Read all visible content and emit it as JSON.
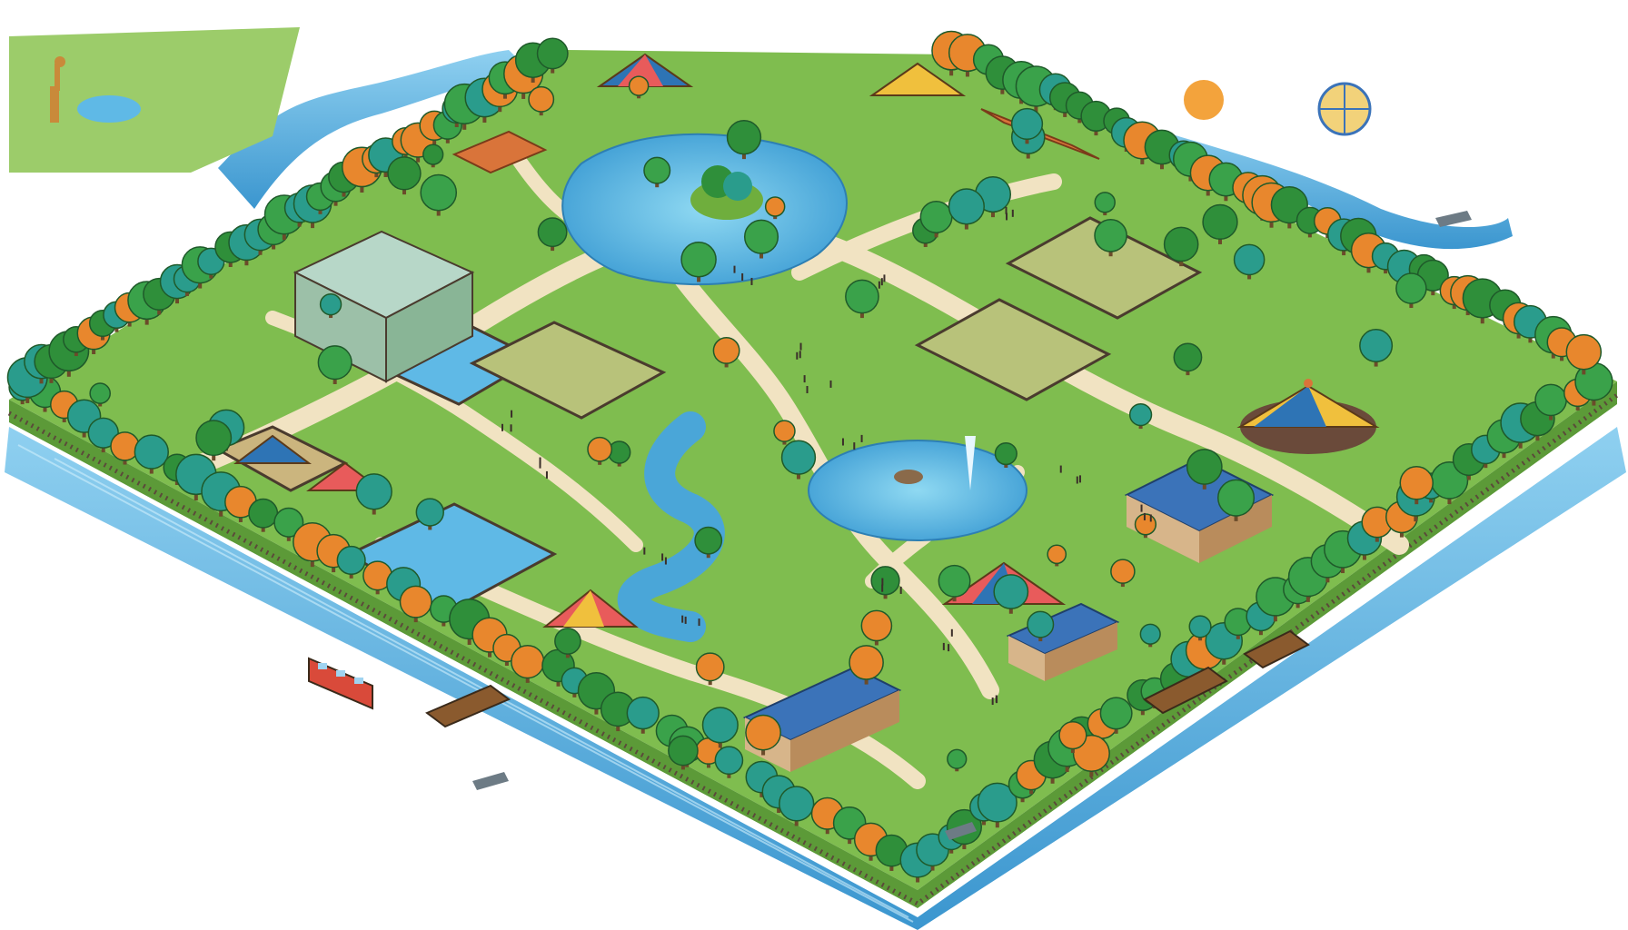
{
  "map": {
    "theme": "isometric-zoo-park-illustration",
    "labels": [],
    "colors": {
      "water": "#4aa6d8",
      "water_light": "#8fd0f0",
      "grass": "#8cc65a",
      "grass_dark": "#5ea33f",
      "path": "#f1e3c2",
      "tree_green": "#2f8f3a",
      "tree_teal": "#2a9c8c",
      "tree_orange": "#e8872d",
      "roof_blue": "#3b73b9",
      "roof_orange": "#d9743a",
      "fence": "#5b4a3a"
    },
    "features": [
      {
        "kind": "river",
        "icon": "river-icon"
      },
      {
        "kind": "central-lake-with-island",
        "icon": "lake-icon"
      },
      {
        "kind": "fountain-pond",
        "icon": "fountain-icon"
      },
      {
        "kind": "winding-stream",
        "icon": "stream-icon"
      },
      {
        "kind": "aviary-greenhouse",
        "icon": "greenhouse-icon"
      },
      {
        "kind": "big-top-tent",
        "icon": "circus-tent-icon"
      },
      {
        "kind": "carousel-pavilions",
        "icon": "pavilion-icon"
      },
      {
        "kind": "animal-enclosures",
        "icon": "enclosure-icon"
      },
      {
        "kind": "blue-roof-barns",
        "icon": "barn-icon"
      },
      {
        "kind": "orange-roof-barns",
        "icon": "barn-icon"
      },
      {
        "kind": "pools",
        "icon": "pool-icon"
      },
      {
        "kind": "wooden-bridges",
        "icon": "bridge-icon"
      },
      {
        "kind": "tour-bus",
        "icon": "bus-icon"
      },
      {
        "kind": "safari-inset",
        "icon": "giraffe-icon"
      },
      {
        "kind": "sun-compass-area",
        "icon": "sun-icon"
      }
    ]
  }
}
